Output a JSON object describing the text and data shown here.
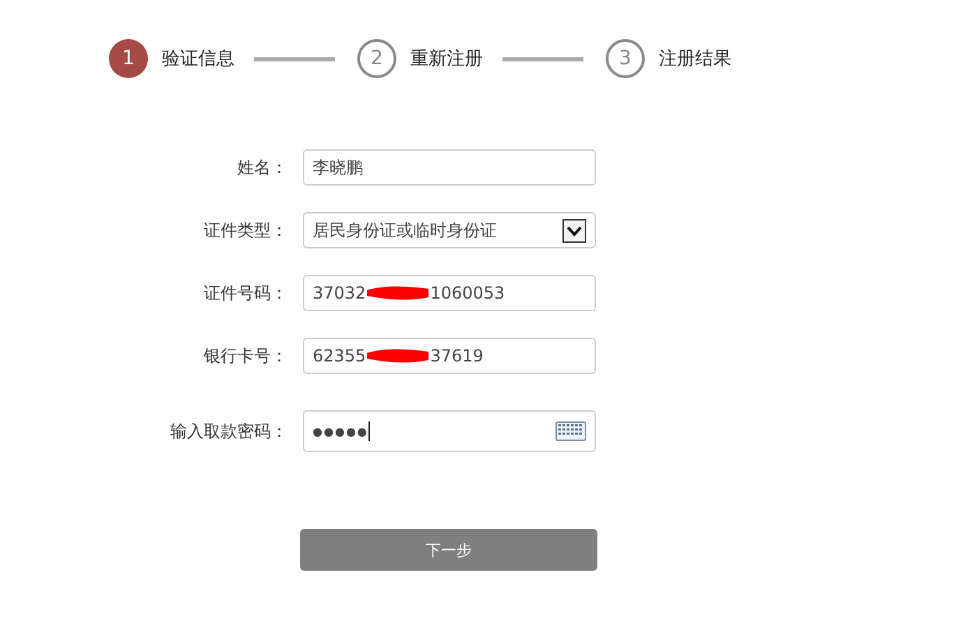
{
  "steps": [
    {
      "number": "1",
      "label": "验证信息",
      "selected": true
    },
    {
      "number": "2",
      "label": "重新注册",
      "selected": false
    },
    {
      "number": "3",
      "label": "注册结果",
      "selected": false
    }
  ],
  "fields": [
    {
      "kind": "text",
      "label": "姓名：",
      "value": "李晓鹏"
    },
    {
      "kind": "select",
      "label": "证件类型：",
      "value": "居民身份证或临时身份证"
    },
    {
      "kind": "redacted",
      "label": "证件号码：",
      "value_start": "37032",
      "value_end": "1060053"
    },
    {
      "kind": "redacted",
      "label": "银行卡号：",
      "value_start": "62355",
      "value_end": "37619"
    },
    {
      "kind": "password",
      "label": "输入取款密码：",
      "value": "●●●●●"
    }
  ],
  "next_button": "下一步"
}
